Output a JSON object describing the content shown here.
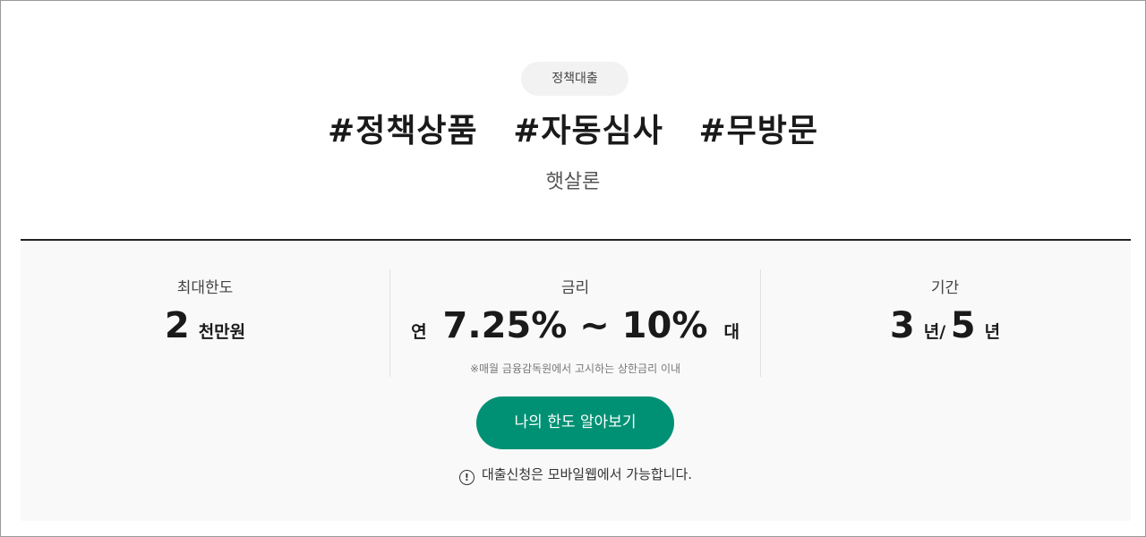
{
  "header": {
    "category": "정책대출",
    "tags": [
      "#정책상품",
      "#자동심사",
      "#무방문"
    ],
    "product_name": "햇살론"
  },
  "info": {
    "limit": {
      "label": "최대한도",
      "value": "2",
      "unit": "천만원"
    },
    "rate": {
      "label": "금리",
      "prefix": "연",
      "value": "7.25% ~ 10%",
      "suffix": "대",
      "note": "※매월 금융감독원에서 고시하는 상한금리 이내"
    },
    "period": {
      "label": "기간",
      "value1": "3",
      "unit1": "년/",
      "value2": "5",
      "unit2": "년"
    }
  },
  "cta": {
    "button_label": "나의 한도 알아보기",
    "notice_icon": "!",
    "notice": "대출신청은 모바일웹에서 가능합니다."
  },
  "colors": {
    "accent": "#009174",
    "panel_bg": "#f9f9f9",
    "chip_bg": "#f2f2f2"
  }
}
